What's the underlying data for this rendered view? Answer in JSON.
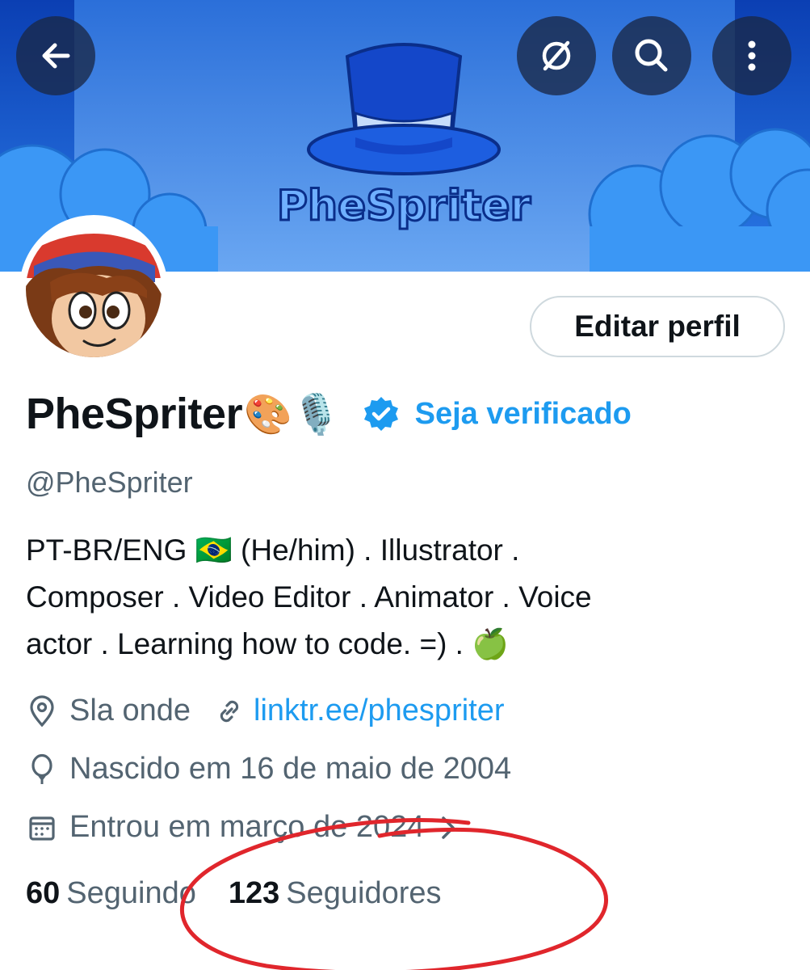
{
  "banner": {
    "logo_text": "PheSpriter",
    "colors": {
      "sky": "#4a88e6",
      "clouds": "#2f8cf0",
      "hat": "#1447c9",
      "band": "#c5dcfb"
    }
  },
  "top_bar": {
    "back_icon": "arrow-left-icon",
    "grok_icon": "slashed-circle-icon",
    "search_icon": "search-icon",
    "more_icon": "more-vertical-icon"
  },
  "profile": {
    "edit_button": "Editar perfil",
    "name": "PheSpriter",
    "name_emojis": "🎨🎙️",
    "verify_link": "Seja verificado",
    "handle": "@PheSpriter",
    "bio_lines": [
      "PT-BR/ENG 🇧🇷  (He/him)  . Illustrator  .",
      "Composer . Video Editor  . Animator  . Voice",
      "actor  . Learning how to code. =) . 🍏"
    ],
    "location": "Sla onde",
    "website": "linktr.ee/phespriter",
    "birthday": "Nascido em 16 de maio de 2004",
    "joined": "Entrou em março de 2024",
    "following_count": "60",
    "following_label": "Seguindo",
    "followers_count": "123",
    "followers_label": "Seguidores"
  },
  "colors": {
    "accent": "#1d9bf0",
    "text": "#0f1419",
    "muted": "#536471",
    "annotation": "#e0262c"
  }
}
